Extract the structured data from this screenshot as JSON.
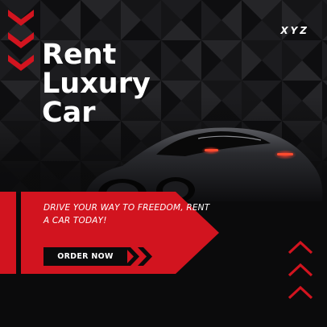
{
  "brand": {
    "logo": "XYZ"
  },
  "headline": {
    "line1": "Rent",
    "line2": "Luxury",
    "line3": "Car"
  },
  "tagline": "DRIVE YOUR WAY TO FREEDOM, RENT A CAR TODAY!",
  "cta": {
    "label": "ORDER NOW"
  },
  "colors": {
    "accent": "#d2141f",
    "background": "#0b0b0c",
    "text": "#ffffff"
  },
  "icons": {
    "top_left": "triple-chevron-down-icon",
    "button": "double-chevron-right-icon",
    "bottom_right": "triple-chevron-up-icon"
  }
}
